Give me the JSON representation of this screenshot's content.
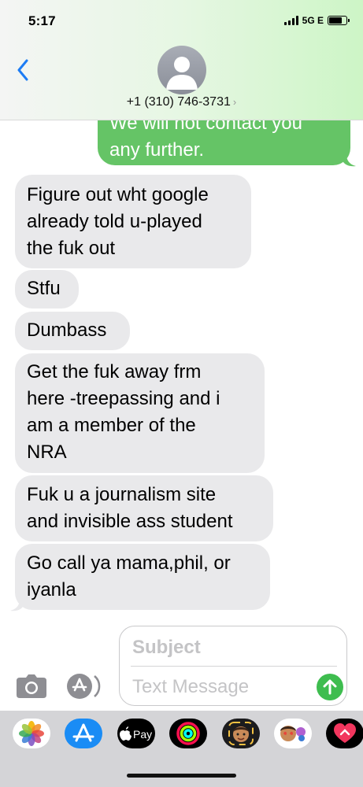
{
  "status_bar": {
    "time": "5:17",
    "network": "5G E"
  },
  "header": {
    "contact": "+1 (310) 746-3731",
    "chevron": "›",
    "back_icon": "chevron-left-icon",
    "avatar_icon": "person-silhouette-icon"
  },
  "messages": [
    {
      "direction": "outgoing",
      "partial": true,
      "lines": [
        "We will not contact you",
        "any further."
      ]
    },
    {
      "direction": "incoming",
      "lines": [
        "Figure out wht google",
        "already told u-played",
        "the fuk out"
      ]
    },
    {
      "direction": "incoming",
      "lines": [
        "Stfu"
      ]
    },
    {
      "direction": "incoming",
      "lines": [
        "Dumbass"
      ]
    },
    {
      "direction": "incoming",
      "lines": [
        "Get the fuk away frm",
        "here -treepassing and i",
        "am a member of the",
        "NRA"
      ]
    },
    {
      "direction": "incoming",
      "lines": [
        "Fuk u a journalism site",
        "and invisible ass student"
      ]
    },
    {
      "direction": "incoming",
      "lines": [
        "Go call ya mama,phil, or",
        "iyanla"
      ]
    }
  ],
  "composer": {
    "subject_placeholder": "Subject",
    "text_placeholder": "Text Message",
    "camera_icon": "camera-icon",
    "apps_icon": "app-store-icon",
    "send_icon": "send-arrow-up-icon"
  },
  "app_drawer": {
    "items": [
      {
        "name": "photos-app-icon"
      },
      {
        "name": "app-store-icon"
      },
      {
        "name": "apple-pay-icon",
        "label": "Pay"
      },
      {
        "name": "activity-rings-icon"
      },
      {
        "name": "memoji-icon"
      },
      {
        "name": "memoji-stickers-icon"
      },
      {
        "name": "digital-touch-icon"
      }
    ]
  },
  "colors": {
    "outgoing_bubble": "#65c466",
    "incoming_bubble": "#e9e9eb",
    "accent_blue": "#1d7cf4",
    "send_green": "#3ebd4f"
  }
}
